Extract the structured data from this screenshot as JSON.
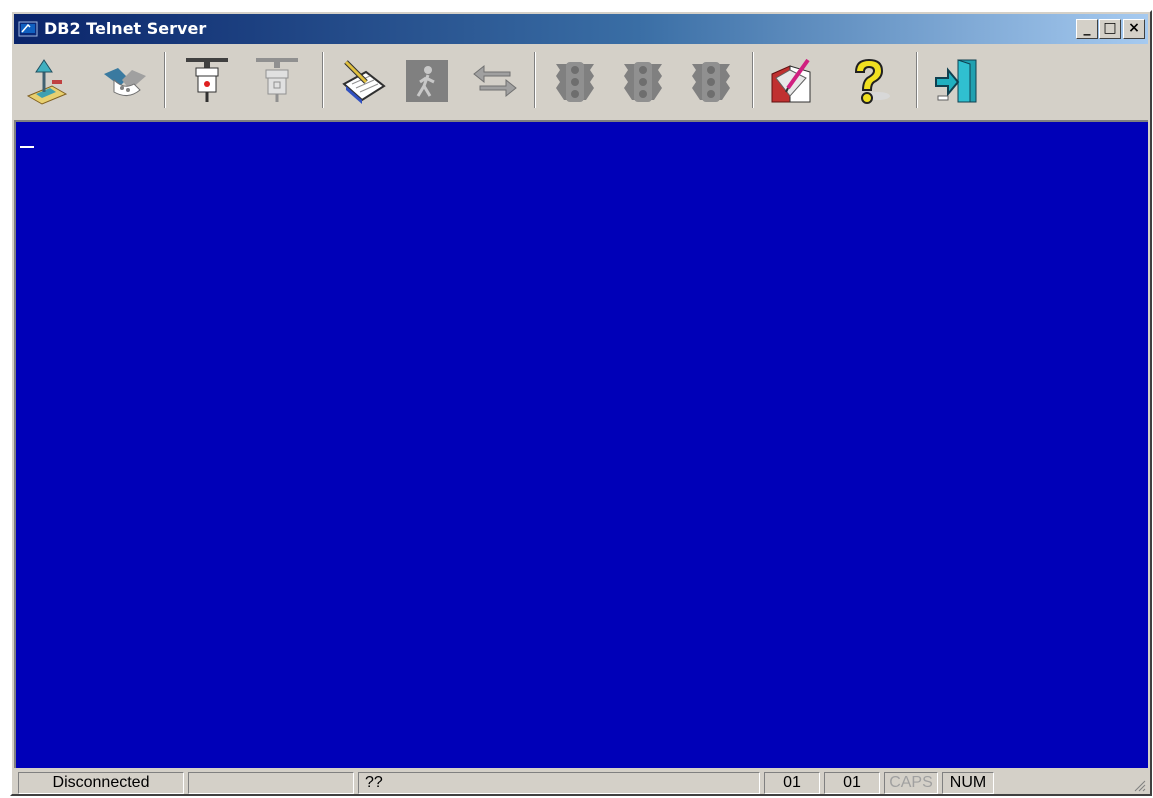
{
  "window": {
    "title": "DB2 Telnet Server",
    "icon": "terminal-app-icon",
    "buttons": {
      "minimize_label": "_",
      "maximize_label": "□",
      "close_label": "×"
    }
  },
  "toolbar": {
    "items": [
      {
        "name": "connect-lamp-icon",
        "enabled": true
      },
      {
        "name": "handshake-icon",
        "enabled": true
      },
      {
        "name": "plug-in-icon",
        "enabled": true
      },
      {
        "name": "plug-out-icon",
        "enabled": false
      },
      {
        "name": "notepad-pencil-icon",
        "enabled": true
      },
      {
        "name": "walking-person-icon",
        "enabled": false
      },
      {
        "name": "transfer-arrows-icon",
        "enabled": false
      },
      {
        "name": "traffic-light-icon-1",
        "enabled": false
      },
      {
        "name": "traffic-light-icon-2",
        "enabled": false
      },
      {
        "name": "traffic-light-icon-3",
        "enabled": false
      },
      {
        "name": "book-edit-icon",
        "enabled": true
      },
      {
        "name": "help-question-icon",
        "enabled": true
      },
      {
        "name": "exit-door-icon",
        "enabled": true
      }
    ]
  },
  "terminal": {
    "background": "#0000b8",
    "cursor_color": "#ffffff"
  },
  "statusbar": {
    "connection": "Disconnected",
    "panel2": "",
    "message": "??",
    "row": "01",
    "col": "01",
    "caps": "CAPS",
    "num": "NUM"
  }
}
